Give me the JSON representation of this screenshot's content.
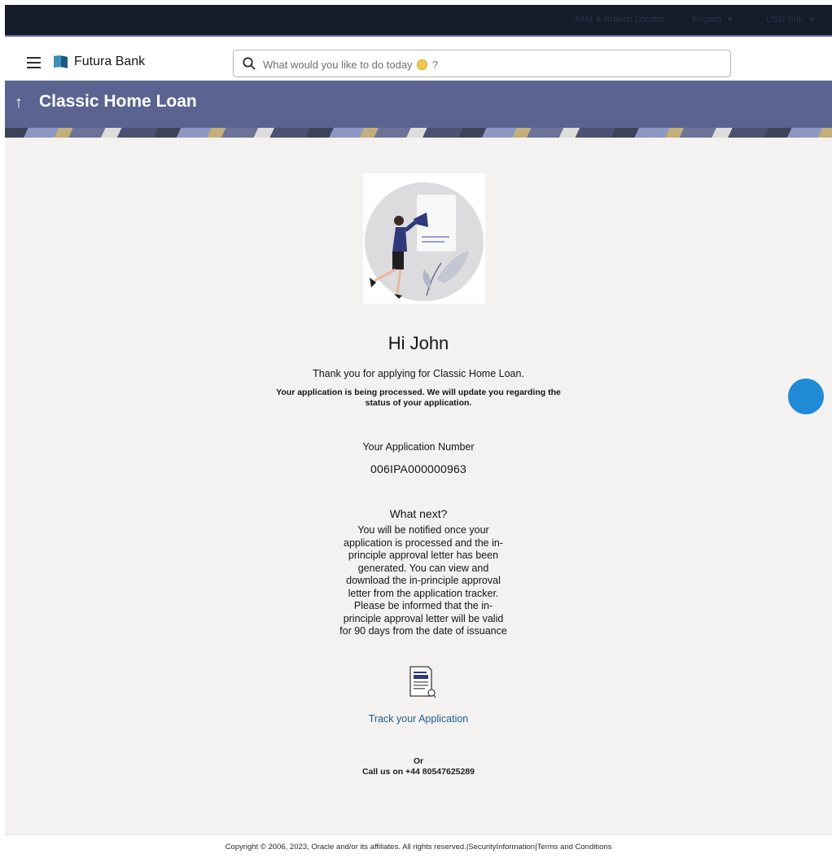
{
  "topbar": {
    "atm_locator": "ATM & Branch Locator",
    "language": "English",
    "user": "USD Sub"
  },
  "header": {
    "brand": "Futura Bank",
    "search_placeholder": "What would you like to do today",
    "search_suffix": "?"
  },
  "banner": {
    "title": "Classic Home Loan"
  },
  "confirmation": {
    "greeting": "Hi John",
    "thanks": "Thank you for applying for Classic Home Loan.",
    "processing": "Your application is being processed. We will update you regarding the status of your application.",
    "application_number_label": "Your Application Number",
    "application_number": "006IPA000000963",
    "what_next_title": "What next?",
    "what_next_body": "You will be notified once your application is processed and the in-principle approval letter has been generated. You can view and download the in-principle approval letter from the application tracker. Please be informed that the in-principle approval letter will be valid for 90 days from the date of issuance",
    "track_link": "Track your Application",
    "or": "Or",
    "call": "Call us on +44 80547625289"
  },
  "footer": {
    "copyright": "Copyright © 2006, 2023, Oracle and/or its affiliates. All rights reserved.|SecurityInformation|Terms and Conditions"
  },
  "colors": {
    "banner": "#5b6490",
    "link": "#1f5d8f",
    "topbar": "#161b29",
    "chat": "#1f8ad6"
  }
}
